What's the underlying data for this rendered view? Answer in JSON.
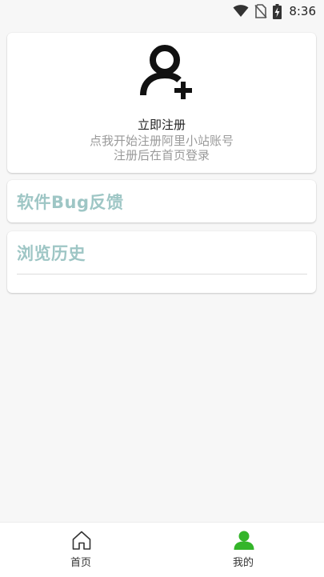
{
  "status_bar": {
    "time": "8:36",
    "icons": [
      "wifi-icon",
      "no-sim-icon",
      "battery-charging-icon"
    ]
  },
  "register_card": {
    "icon": "add-user-icon",
    "title": "立即注册",
    "description_line1": "点我开始注册阿里小站账号",
    "description_line2": "注册后在首页登录"
  },
  "feedback_card": {
    "label": "软件Bug反馈"
  },
  "history_card": {
    "label": "浏览历史"
  },
  "bottom_nav": {
    "items": [
      {
        "label": "首页",
        "icon": "home-icon",
        "active": false
      },
      {
        "label": "我的",
        "icon": "person-icon",
        "active": true
      }
    ]
  },
  "colors": {
    "accent_green": "#34b52a",
    "heading_teal": "#9ec6c5",
    "secondary_text": "#9a9a9a",
    "background": "#f7f7f7"
  }
}
